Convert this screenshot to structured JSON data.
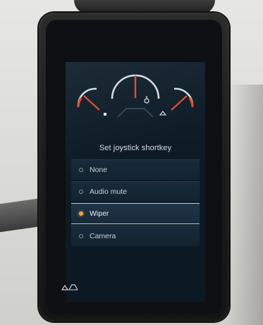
{
  "screen": {
    "title": "Set joystick shortkey",
    "options": [
      {
        "label": "None",
        "selected": false
      },
      {
        "label": "Audio mute",
        "selected": false
      },
      {
        "label": "Wiper",
        "selected": true
      },
      {
        "label": "Camera",
        "selected": false
      }
    ]
  },
  "gauges": {
    "needle_color": "#e04a2f",
    "arc_color": "#d9dde2",
    "icons": [
      "fuel-icon",
      "engine-temp-icon",
      "oil-icon"
    ]
  },
  "colors": {
    "screen_bg": "#0d1b26",
    "accent": "#f2a13a",
    "text": "#c9d0d7"
  },
  "footer": {
    "icons": [
      "loader-arm-icon"
    ]
  }
}
